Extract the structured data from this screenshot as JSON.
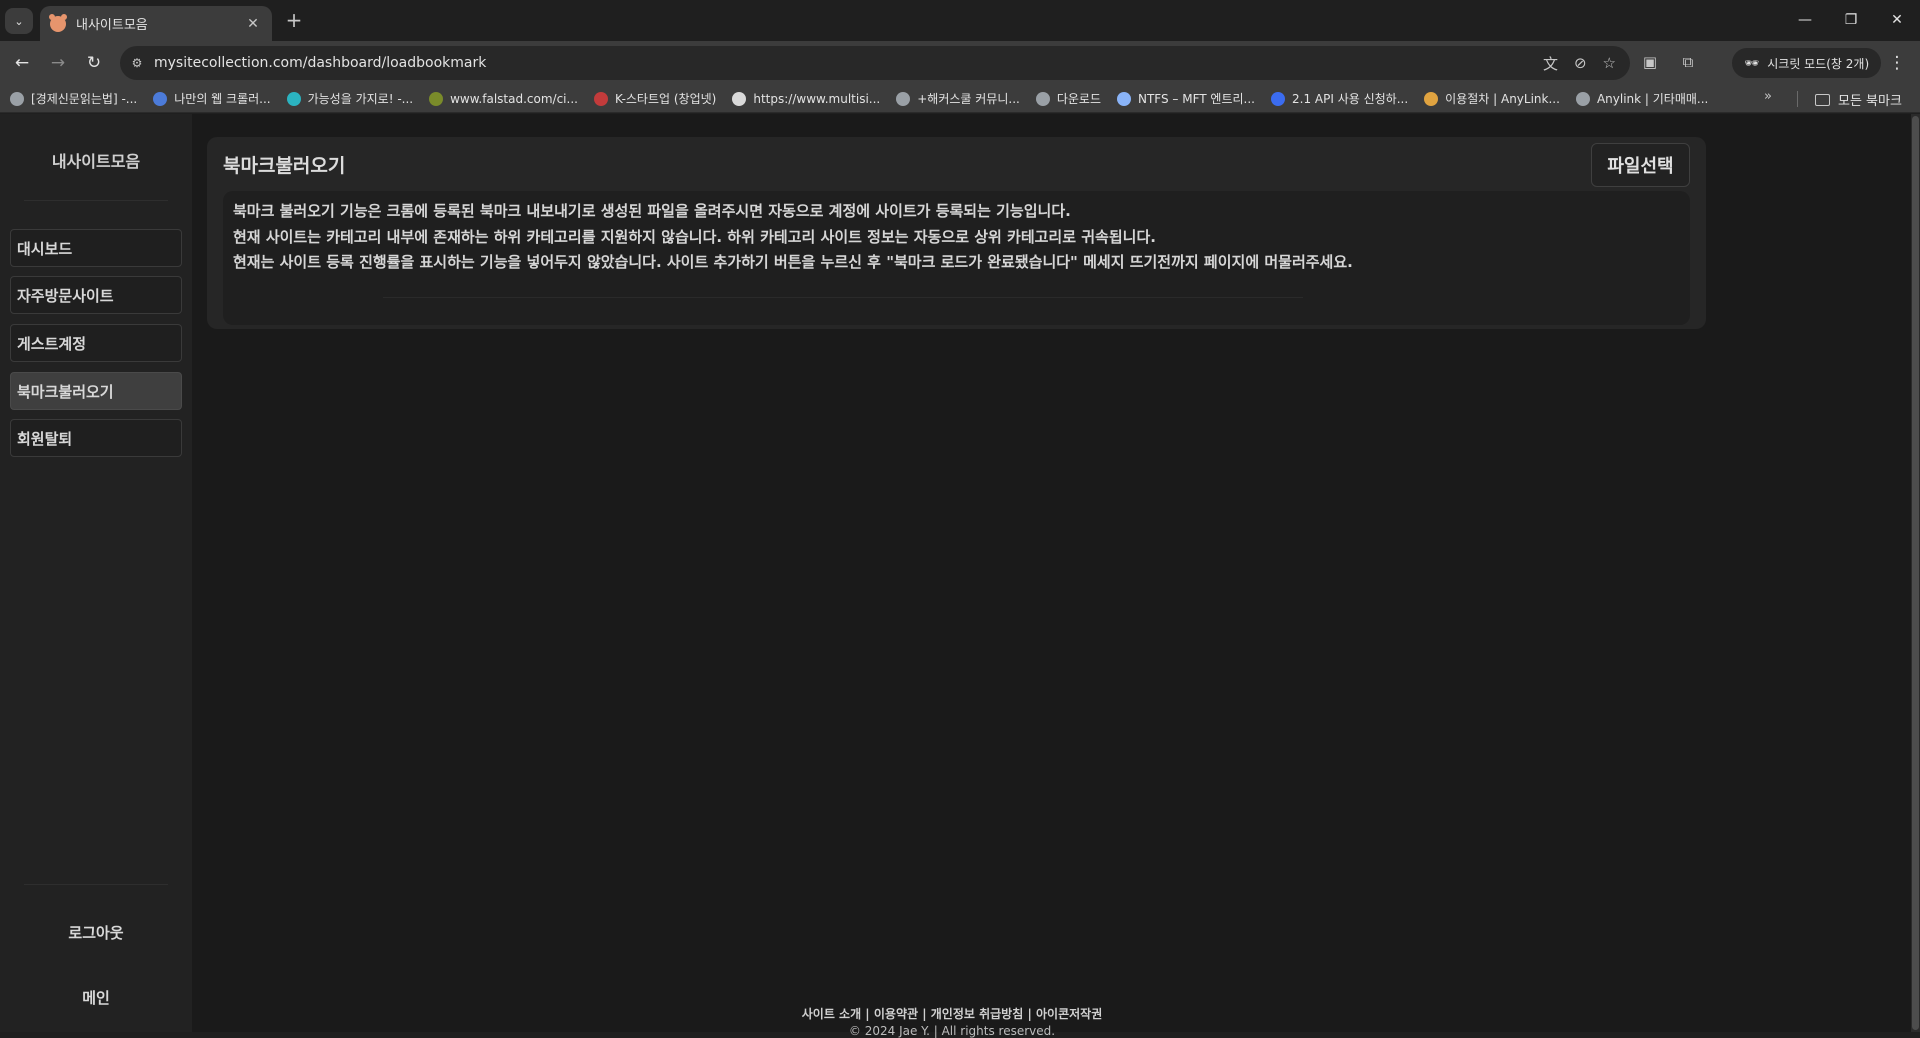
{
  "browser": {
    "tab_title": "내사이트모음",
    "url": "mysitecollection.com/dashboard/loadbookmark",
    "incognito_label": "시크릿 모드(창 2개)",
    "all_bookmarks_label": "모든 북마크",
    "bookmarks": [
      {
        "label": "[경제신문읽는법] -...",
        "color": "#9aa0a6"
      },
      {
        "label": "나만의 웹 크롤러...",
        "color": "#4c7bd9"
      },
      {
        "label": "가능성을 가지로! -...",
        "color": "#2bb3c0"
      },
      {
        "label": "www.falstad.com/ci...",
        "color": "#7a8b2a"
      },
      {
        "label": "K-스타트업 (창업넷)",
        "color": "#c23b3b"
      },
      {
        "label": "https://www.multisi...",
        "color": "#d9d9d9"
      },
      {
        "label": "+해커스쿨 커뮤니...",
        "color": "#9aa0a6"
      },
      {
        "label": "다운로드",
        "color": "#9aa0a6"
      },
      {
        "label": "NTFS – MFT 엔트리...",
        "color": "#8ab4f8"
      },
      {
        "label": "2.1 API 사용 신청하...",
        "color": "#3b6cf0"
      },
      {
        "label": "이용절차 | AnyLink...",
        "color": "#e0a340"
      },
      {
        "label": "Anylink | 기타매매...",
        "color": "#9aa0a6"
      }
    ]
  },
  "sidebar": {
    "brand": "내사이트모음",
    "items": [
      {
        "label": "대시보드",
        "active": false
      },
      {
        "label": "자주방문사이트",
        "active": false
      },
      {
        "label": "게스트계정",
        "active": false
      },
      {
        "label": "북마크불러오기",
        "active": true
      },
      {
        "label": "회원탈퇴",
        "active": false
      }
    ],
    "logout_label": "로그아웃",
    "main_label": "메인"
  },
  "main": {
    "title": "북마크불러오기",
    "file_button_label": "파일선택",
    "info_lines": [
      "북마크 불러오기 기능은 크롬에 등록된 북마크 내보내기로 생성된 파일을 올려주시면 자동으로 계정에 사이트가 등록되는 기능입니다.",
      "현재 사이트는 카테고리 내부에 존재하는 하위 카테고리를 지원하지 않습니다. 하위 카테고리 사이트 정보는 자동으로 상위 카테고리로 귀속됩니다.",
      "현재는 사이트 등록 진행률을 표시하는 기능을 넣어두지 않았습니다. 사이트 추가하기 버튼을 누르신 후 \"북마크 로드가 완료됐습니다\" 메세지 뜨기전까지 페이지에 머물러주세요."
    ]
  },
  "footer": {
    "links": "사이트 소개 | 이용약관 | 개인정보 취급방침 | 아이콘저작권",
    "copyright": "© 2024 Jae Y. | All rights reserved."
  }
}
